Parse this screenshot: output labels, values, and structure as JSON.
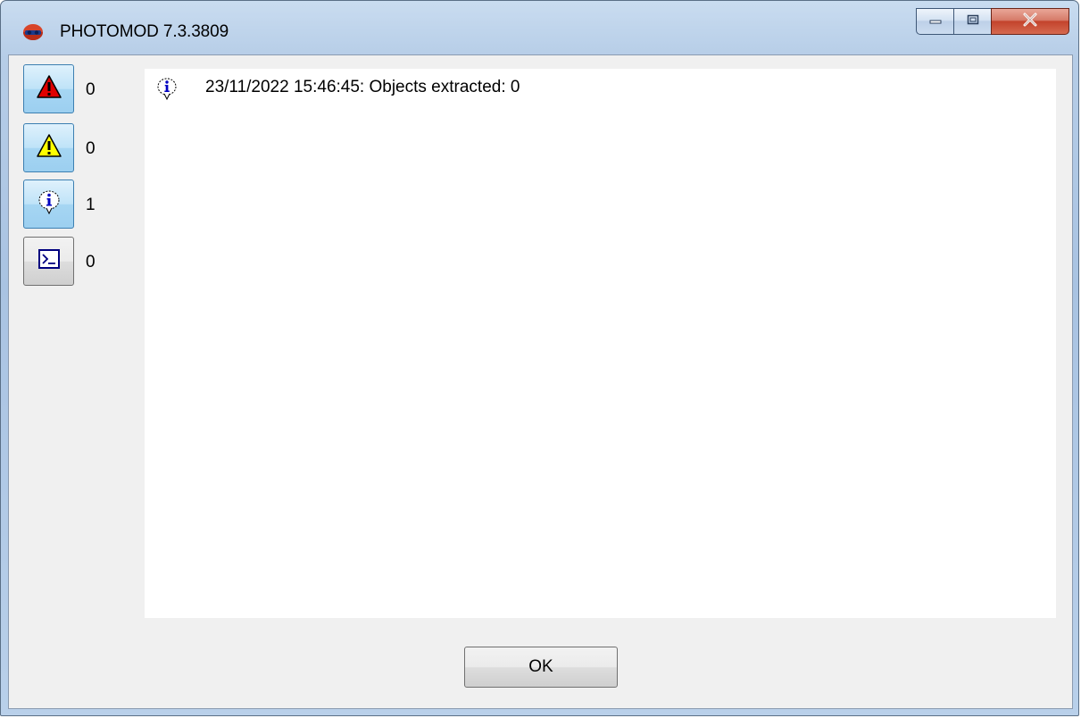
{
  "window": {
    "title": "PHOTOMOD 7.3.3809",
    "app_icon": "photomod-logo-icon",
    "caption_buttons": [
      "minimize-icon",
      "restore-icon",
      "close-icon"
    ]
  },
  "filters": [
    {
      "icon": "error-icon",
      "count": "0",
      "color": "#e00000",
      "active": true
    },
    {
      "icon": "warning-icon",
      "count": "0",
      "color": "#ffff00",
      "active": true
    },
    {
      "icon": "info-icon",
      "count": "1",
      "color": "#0000c0",
      "active": true
    },
    {
      "icon": "console-icon",
      "count": "0",
      "color": "#00007f",
      "active": false
    }
  ],
  "log": [
    {
      "icon": "info-icon",
      "text": "23/11/2022 15:46:45: Objects extracted: 0"
    }
  ],
  "buttons": {
    "ok_label": "OK"
  }
}
